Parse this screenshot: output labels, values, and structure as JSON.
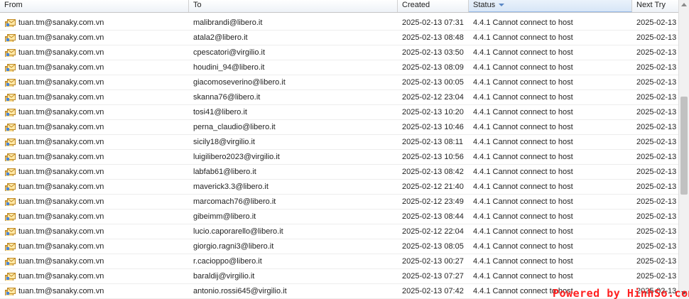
{
  "columns": {
    "from": "From",
    "to": "To",
    "created": "Created",
    "status": "Status",
    "next_try": "Next Try"
  },
  "sort": {
    "column": "Status",
    "direction": "descending"
  },
  "icons": {
    "row_icon": "email-queue-icon"
  },
  "colors": {
    "watermark": "#ff2020",
    "sorted_header": "#d7e6f7"
  },
  "rows": [
    {
      "from": "tuan.tm@sanaky.com.vn",
      "to": "malibrandi@libero.it",
      "created": "2025-02-13 07:31",
      "status": "4.4.1 Cannot connect to host",
      "next_try": "2025-02-13"
    },
    {
      "from": "tuan.tm@sanaky.com.vn",
      "to": "atala2@libero.it",
      "created": "2025-02-13 08:48",
      "status": "4.4.1 Cannot connect to host",
      "next_try": "2025-02-13"
    },
    {
      "from": "tuan.tm@sanaky.com.vn",
      "to": "cpescatori@virgilio.it",
      "created": "2025-02-13 03:50",
      "status": "4.4.1 Cannot connect to host",
      "next_try": "2025-02-13"
    },
    {
      "from": "tuan.tm@sanaky.com.vn",
      "to": "houdini_94@libero.it",
      "created": "2025-02-13 08:09",
      "status": "4.4.1 Cannot connect to host",
      "next_try": "2025-02-13"
    },
    {
      "from": "tuan.tm@sanaky.com.vn",
      "to": "giacomoseverino@libero.it",
      "created": "2025-02-13 00:05",
      "status": "4.4.1 Cannot connect to host",
      "next_try": "2025-02-13"
    },
    {
      "from": "tuan.tm@sanaky.com.vn",
      "to": "skanna76@libero.it",
      "created": "2025-02-12 23:04",
      "status": "4.4.1 Cannot connect to host",
      "next_try": "2025-02-13"
    },
    {
      "from": "tuan.tm@sanaky.com.vn",
      "to": "tosi41@libero.it",
      "created": "2025-02-13 10:20",
      "status": "4.4.1 Cannot connect to host",
      "next_try": "2025-02-13"
    },
    {
      "from": "tuan.tm@sanaky.com.vn",
      "to": "perna_claudio@libero.it",
      "created": "2025-02-13 10:46",
      "status": "4.4.1 Cannot connect to host",
      "next_try": "2025-02-13"
    },
    {
      "from": "tuan.tm@sanaky.com.vn",
      "to": "sicily18@virgilio.it",
      "created": "2025-02-13 08:11",
      "status": "4.4.1 Cannot connect to host",
      "next_try": "2025-02-13"
    },
    {
      "from": "tuan.tm@sanaky.com.vn",
      "to": "luigilibero2023@virgilio.it",
      "created": "2025-02-13 10:56",
      "status": "4.4.1 Cannot connect to host",
      "next_try": "2025-02-13"
    },
    {
      "from": "tuan.tm@sanaky.com.vn",
      "to": "labfab61@libero.it",
      "created": "2025-02-13 08:42",
      "status": "4.4.1 Cannot connect to host",
      "next_try": "2025-02-13"
    },
    {
      "from": "tuan.tm@sanaky.com.vn",
      "to": "maverick3.3@libero.it",
      "created": "2025-02-12 21:40",
      "status": "4.4.1 Cannot connect to host",
      "next_try": "2025-02-13"
    },
    {
      "from": "tuan.tm@sanaky.com.vn",
      "to": "marcomach76@libero.it",
      "created": "2025-02-12 23:49",
      "status": "4.4.1 Cannot connect to host",
      "next_try": "2025-02-13"
    },
    {
      "from": "tuan.tm@sanaky.com.vn",
      "to": "gibeimm@libero.it",
      "created": "2025-02-13 08:44",
      "status": "4.4.1 Cannot connect to host",
      "next_try": "2025-02-13"
    },
    {
      "from": "tuan.tm@sanaky.com.vn",
      "to": "lucio.caporarello@libero.it",
      "created": "2025-02-12 22:04",
      "status": "4.4.1 Cannot connect to host",
      "next_try": "2025-02-13"
    },
    {
      "from": "tuan.tm@sanaky.com.vn",
      "to": "giorgio.ragni3@libero.it",
      "created": "2025-02-13 08:05",
      "status": "4.4.1 Cannot connect to host",
      "next_try": "2025-02-13"
    },
    {
      "from": "tuan.tm@sanaky.com.vn",
      "to": "r.cacioppo@libero.it",
      "created": "2025-02-13 00:27",
      "status": "4.4.1 Cannot connect to host",
      "next_try": "2025-02-13"
    },
    {
      "from": "tuan.tm@sanaky.com.vn",
      "to": "baraldij@virgilio.it",
      "created": "2025-02-13 07:27",
      "status": "4.4.1 Cannot connect to host",
      "next_try": "2025-02-13"
    },
    {
      "from": "tuan.tm@sanaky.com.vn",
      "to": "antonio.rossi645@virgilio.it",
      "created": "2025-02-13 07:42",
      "status": "4.4.1 Cannot connect to host",
      "next_try": "2025-02-13"
    }
  ],
  "watermark": "Powered by HinhSo.com"
}
